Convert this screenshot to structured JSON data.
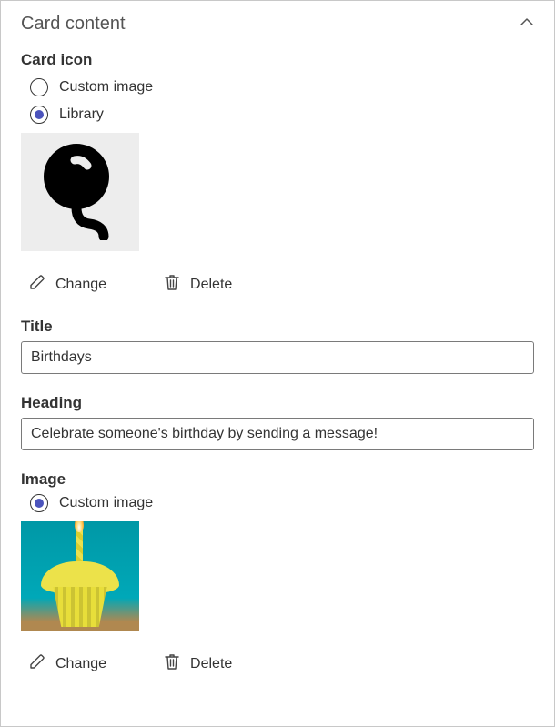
{
  "panel": {
    "title": "Card content"
  },
  "cardIcon": {
    "label": "Card icon",
    "options": {
      "custom": "Custom image",
      "library": "Library"
    },
    "selected": "library",
    "change": "Change",
    "delete": "Delete"
  },
  "title": {
    "label": "Title",
    "value": "Birthdays"
  },
  "heading": {
    "label": "Heading",
    "value": "Celebrate someone's birthday by sending a message!"
  },
  "image": {
    "label": "Image",
    "options": {
      "custom": "Custom image"
    },
    "selected": "custom",
    "change": "Change",
    "delete": "Delete"
  }
}
